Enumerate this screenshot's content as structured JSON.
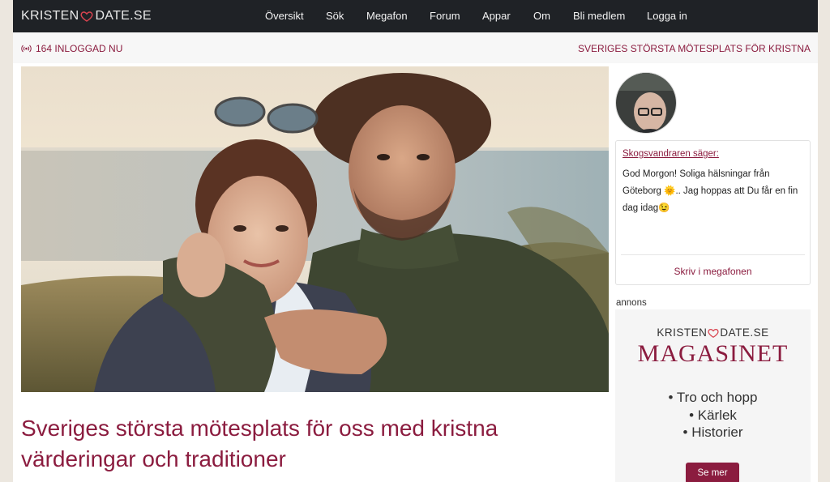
{
  "brand": {
    "part1": "KRISTEN",
    "part2": "DATE.SE",
    "accent": "#8b1c3f"
  },
  "nav": {
    "items": [
      "Översikt",
      "Sök",
      "Megafon",
      "Forum",
      "Appar",
      "Om",
      "Bli medlem",
      "Logga in"
    ]
  },
  "status": {
    "online": "164 INLOGGAD NU",
    "tagline": "SVERIGES STÖRSTA MÖTESPLATS FÖR KRISTNA"
  },
  "hero": {
    "headline": "Sveriges största mötesplats för oss med kristna värderingar och traditioner"
  },
  "megaphone": {
    "speaker": "Skogsvandraren säger:",
    "message": "God Morgon! Soliga hälsningar från Göteborg 🌞.. Jag hoppas att Du får en fin dag idag😉",
    "write_link": "Skriv i megafonen"
  },
  "ad": {
    "label": "annons",
    "brand1": "KRISTEN",
    "brand2": "DATE.SE",
    "title": "MAGASINET",
    "items": [
      "• Tro och hopp",
      "• Kärlek",
      "• Historier"
    ],
    "button": "Se mer"
  },
  "icons": {
    "heart": "heart-icon",
    "online": "broadcast-icon"
  }
}
